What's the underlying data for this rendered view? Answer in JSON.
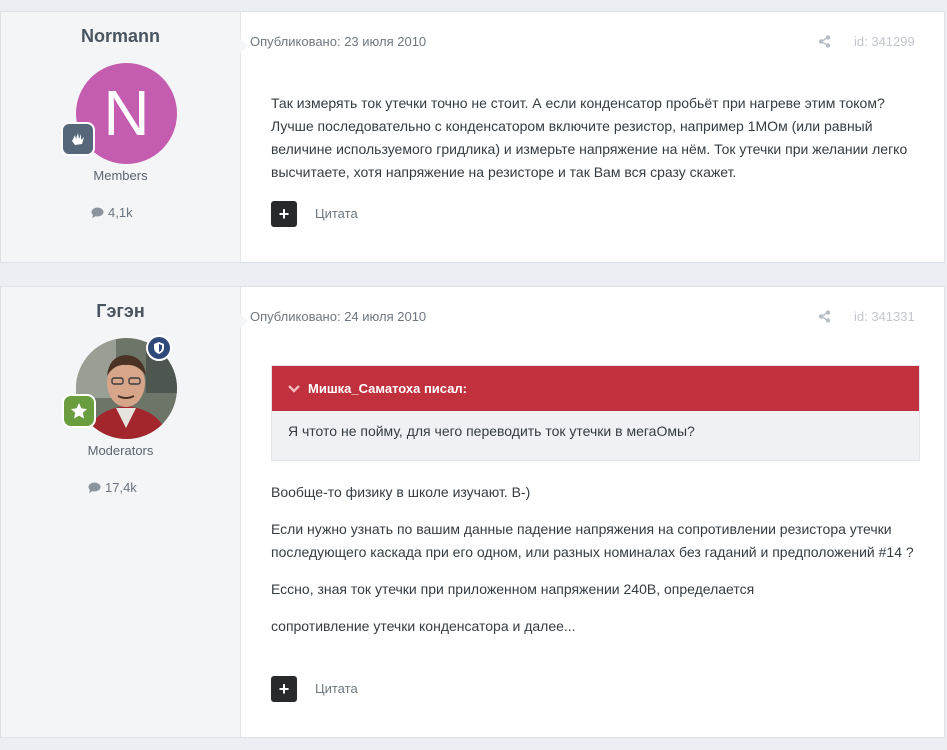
{
  "posts": [
    {
      "author": "Normann",
      "avatar_letter": "N",
      "avatar_color": "#c45db0",
      "group": "Members",
      "post_count": "4,1k",
      "date": "Опубликовано: 23 июля 2010",
      "post_id": "id: 341299",
      "paragraphs": [
        "Так измерять ток утечки точно не стоит. А если конденсатор пробьёт при нагреве этим током? Лучше последовательно с конденсатором включите резистор, например 1МОм (или равный величине используемого гридлика) и измерьте напряжение на нём. Ток утечки при желании легко высчитаете, хотя напряжение на резисторе и так Вам вся сразу скажет."
      ],
      "quote_label": "Цитата"
    },
    {
      "author": "Гэгэн",
      "group": "Moderators",
      "post_count": "17,4k",
      "date": "Опубликовано: 24 июля 2010",
      "post_id": "id: 341331",
      "quote": {
        "author": "Мишка_Саматоха писал:",
        "text": "Я чтото не пойму, для чего переводить ток утечки в мегаОмы?"
      },
      "paragraphs": [
        "Вообще-то физику в школе изучают. B-)",
        "Если нужно узнать по вашим данные падение напряжения на сопротивлении резистора утечки последующего каскада при его одном, или разных номиналах без гаданий и предположений #14 ?",
        "Ессно, зная ток утечки при приложенном напряжении 240В, определается",
        "сопротивление утечки конденсатора и далее..."
      ],
      "quote_label": "Цитата"
    }
  ]
}
